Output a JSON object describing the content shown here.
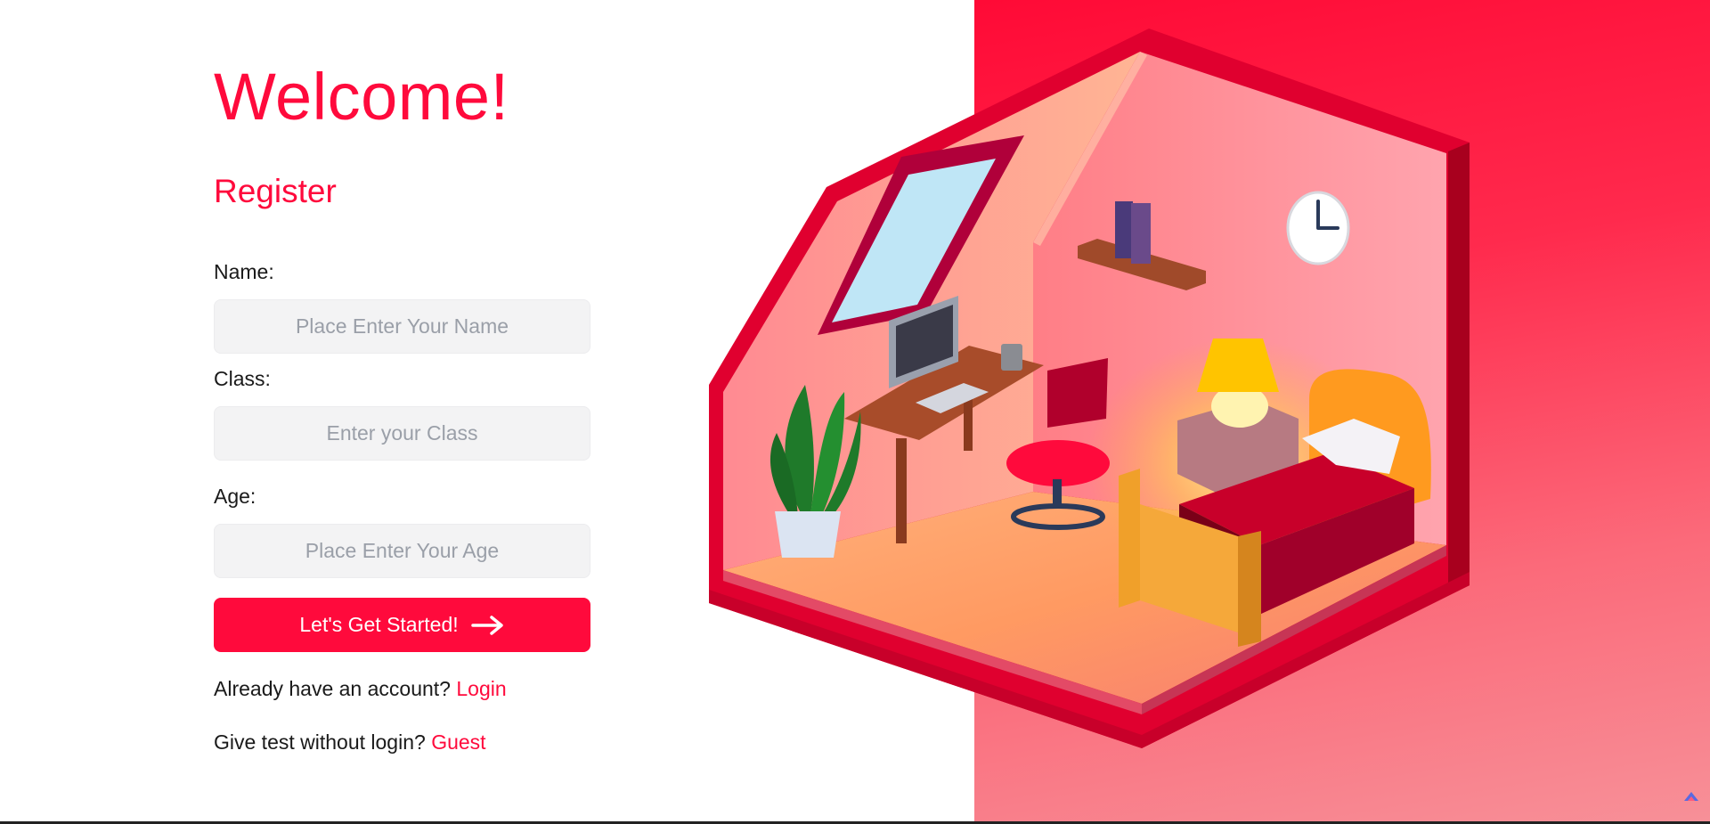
{
  "page": {
    "welcome_title": "Welcome!",
    "register_heading": "Register"
  },
  "form": {
    "name": {
      "label": "Name:",
      "placeholder": "Place Enter Your Name"
    },
    "class": {
      "label": "Class:",
      "placeholder": "Enter your Class"
    },
    "age": {
      "label": "Age:",
      "placeholder": "Place Enter Your Age"
    },
    "submit_label": "Let's Get Started!"
  },
  "footer": {
    "login_prompt": "Already have an account?",
    "login_link": "Login",
    "guest_prompt": "Give test without login?",
    "guest_link": "Guest"
  },
  "colors": {
    "accent": "#ff0a3c",
    "input_bg": "#f3f3f4",
    "placeholder": "#9a9fa8"
  },
  "icons": {
    "submit_icon": "arrow-right-icon",
    "illustration": "isometric-bedroom-illustration"
  }
}
